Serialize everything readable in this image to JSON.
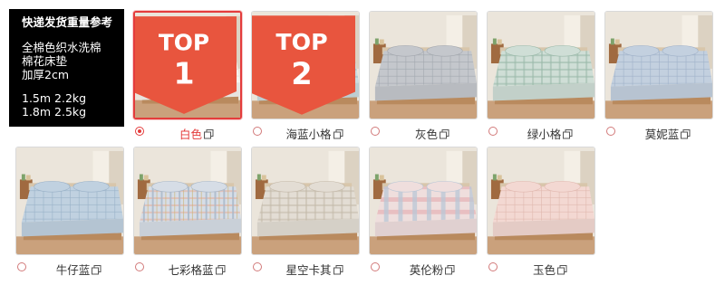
{
  "info_panel": {
    "title": "快递发货重量参考",
    "description": "全棉色织水洗棉\n棉花床垫\n加厚2cm",
    "weights": [
      "1.5m 2.2kg",
      "1.8m 2.5kg"
    ]
  },
  "swatches": [
    {
      "label": "白色",
      "selected": true,
      "badge": {
        "text": "TOP",
        "rank": "1"
      },
      "base": "#f6f3ee",
      "line": "#ddd6cc",
      "check": "none"
    },
    {
      "label": "海蓝小格",
      "selected": false,
      "badge": {
        "text": "TOP",
        "rank": "2"
      },
      "base": "#c9dbe0",
      "line": "#97b5bf",
      "check": "small"
    },
    {
      "label": "灰色",
      "selected": false,
      "badge": null,
      "base": "#c4c7cc",
      "line": "#a2a6ad",
      "check": "none"
    },
    {
      "label": "绿小格",
      "selected": false,
      "badge": null,
      "base": "#cfded6",
      "line": "#99b8a8",
      "check": "small"
    },
    {
      "label": "莫妮蓝",
      "selected": false,
      "badge": null,
      "base": "#c3d0df",
      "line": "#9fb0c8",
      "check": "none"
    },
    {
      "label": "牛仔蓝",
      "selected": false,
      "badge": null,
      "base": "#c0d1e0",
      "line": "#98b0c7",
      "check": "none"
    },
    {
      "label": "七彩格蓝",
      "selected": false,
      "badge": null,
      "base": "#d6dde6",
      "line": "#a6b6c8",
      "check": "multi"
    },
    {
      "label": "星空卡其",
      "selected": false,
      "badge": null,
      "base": "#e3ddd4",
      "line": "#c3b8a8",
      "check": "small"
    },
    {
      "label": "英伦粉",
      "selected": false,
      "badge": null,
      "base": "#efdedd",
      "line": "#b9c6d6",
      "check": "plaid"
    },
    {
      "label": "玉色",
      "selected": false,
      "badge": null,
      "base": "#f3d8d2",
      "line": "#e0b7ae",
      "check": "none"
    }
  ],
  "colors": {
    "accent": "#e43c3c",
    "badge": "#e8553e",
    "wall": "#ebe5db",
    "floor": "#caa17c",
    "shelf": "#a06a40"
  },
  "icons": {
    "zoom": "zoom-preview-icon",
    "radio": "radio-button"
  }
}
